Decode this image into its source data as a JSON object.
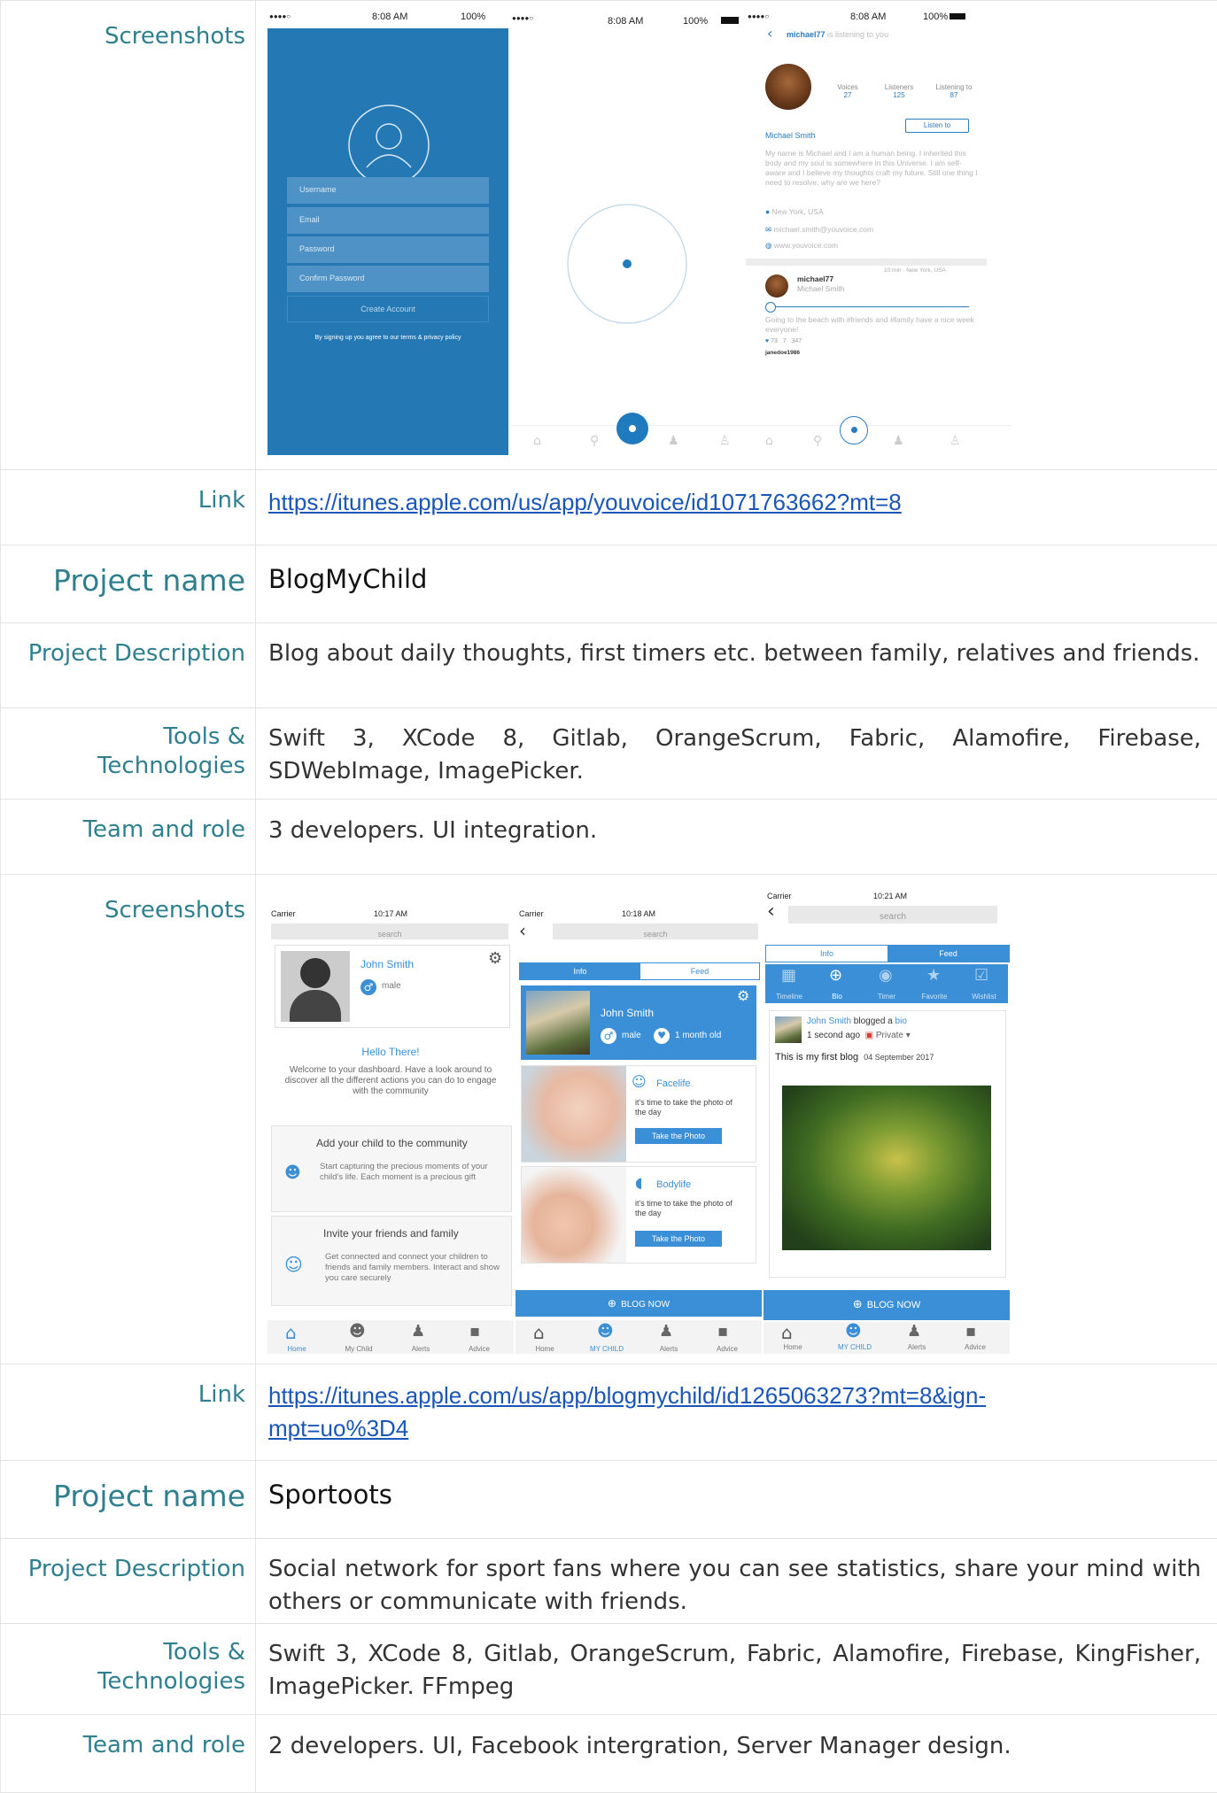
{
  "labels": {
    "screenshots": "Screenshots",
    "link": "Link",
    "project_name": "Project name",
    "project_description": "Project Description",
    "tools_line1": "Tools &",
    "tools_line2": "Technologies",
    "team": "Team and role"
  },
  "youvoice": {
    "link": "https://itunes.apple.com/us/app/youvoice/id1071763662?mt=8",
    "screen1": {
      "dots": "●●●●○",
      "time": "8:08 AM",
      "battery": "100%",
      "fields": [
        "Username",
        "Email",
        "Password",
        "Confirm Password"
      ],
      "button": "Create Account",
      "terms": "By signing up you agree to our terms & privacy policy"
    },
    "screen2": {
      "dots": "●●●●○",
      "time": "8:08 AM",
      "battery": "100%"
    },
    "screen3": {
      "dots": "●●●●○",
      "time": "8:08 AM",
      "battery": "100%",
      "back": "‹",
      "title_user": "michael77",
      "title_rest": " is listening to you",
      "stats": [
        {
          "label": "Voices",
          "value": "27"
        },
        {
          "label": "Listeners",
          "value": "125"
        },
        {
          "label": "Listening to",
          "value": "87"
        }
      ],
      "listen_button": "Listen to",
      "name": "Michael Smith",
      "bio": "My name is Michael and I am a human being. I inherited this body and my soul is somewhere in this Universe. I am self-aware and I believe my thoughts craft my future. Still one thing I need to resolve, why are we here?",
      "location": "New York, USA",
      "email": "michael.smith@youvoice.com",
      "web": "www.youvoice.com",
      "post_user": "michael77",
      "post_name": "Michael Smith",
      "post_meta": "10 min  ·  New York, USA",
      "post_text": "Going to the beach with #friends and #family have a nice week everyone!",
      "counts": [
        "73",
        "7",
        "347"
      ],
      "footer": "janedoe1986"
    }
  },
  "blogmychild": {
    "project_name": "BlogMyChild",
    "description": "Blog about daily thoughts, first timers etc. between family, relatives and friends.",
    "tools": "Swift 3, XCode 8, Gitlab, OrangeScrum, Fabric, Alamofire, Firebase, SDWebImage, ImagePicker.",
    "team": "3 developers. UI integration.",
    "link_line1": "https://itunes.apple.com/us/app/blogmychild/id1265063273?mt=8&ign-",
    "link_line2": "mpt=uo%3D4",
    "screen1": {
      "carrier": "Carrier",
      "time": "10:17 AM",
      "search": "search",
      "child_name": "John Smith",
      "gender": "male",
      "hello": "Hello There!",
      "welcome": "Welcome to your dashboard. Have a look around to discover all the different actions you can do to engage with the community",
      "card1_title": "Add your child to the community",
      "card1_text": "Start capturing the precious moments of your child's life. Each moment is a precious gift",
      "card2_title": "Invite your friends and family",
      "card2_text": "Get connected and connect your children to friends and family members. Interact and show you care securely",
      "tabs": [
        "Home",
        "My Child",
        "Alerts",
        "Advice"
      ]
    },
    "screen2": {
      "carrier": "Carrier",
      "time": "10:18 AM",
      "search": "search",
      "seg": [
        "Info",
        "Feed"
      ],
      "child_name": "John Smith",
      "gender": "male",
      "age": "1 month old",
      "face_title": "Facelife",
      "face_text": "it's time to take the photo of the day",
      "body_title": "Bodylife",
      "body_text": "it's time to take the photo of the day",
      "take_photo": "Take the Photo",
      "blog_now": "BLOG NOW",
      "tabs": [
        "Home",
        "MY CHILD",
        "Alerts",
        "Advice"
      ]
    },
    "screen3": {
      "carrier": "Carrier",
      "time": "10:21 AM",
      "search": "search",
      "seg": [
        "Info",
        "Feed"
      ],
      "icons": [
        "Timeline",
        "Bio",
        "Timer",
        "Favorite",
        "Wishlist"
      ],
      "post_author": "John Smith",
      "post_action": " blogged a ",
      "post_type": "bio",
      "post_time": "1 second ago",
      "privacy": "Private",
      "post_text": "This is my first blog",
      "post_date": "04 September 2017",
      "blog_now": "BLOG NOW",
      "tabs": [
        "Home",
        "MY CHILD",
        "Alerts",
        "Advice"
      ]
    }
  },
  "sportoots": {
    "project_name": "Sportoots",
    "description": "Social network for sport fans where you can see statistics, share your mind with others or communicate with friends.",
    "tools": "Swift 3, XCode 8, Gitlab, OrangeScrum, Fabric, Alamofire, Firebase, KingFisher, ImagePicker. FFmpeg",
    "team": "2 developers. UI, Facebook intergration, Server Manager design."
  }
}
